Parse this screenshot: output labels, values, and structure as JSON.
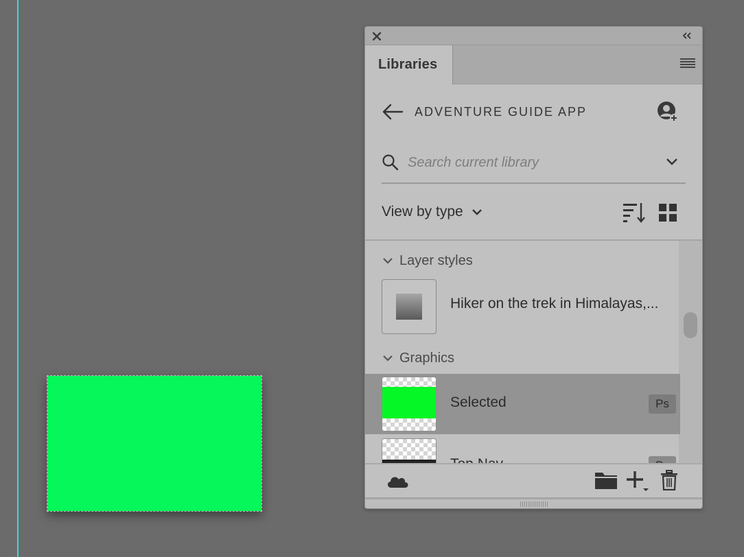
{
  "canvas": {
    "guide_color": "#3fd6dc",
    "shape_color": "#05f75a"
  },
  "panel": {
    "close_icon": "close-icon",
    "collapse_icon": "double-chevron-left-icon",
    "menu_icon": "hamburger-menu-icon",
    "tab_label": "Libraries",
    "library": {
      "back_icon": "arrow-left-icon",
      "title": "ADVENTURE GUIDE APP",
      "user_icon": "add-user-icon"
    },
    "search": {
      "placeholder": "Search current library",
      "value": "",
      "icon": "search-icon",
      "dropdown_icon": "chevron-down-icon"
    },
    "view": {
      "label": "View by type",
      "sort_icon": "sort-icon",
      "grid_icon": "grid-view-icon"
    },
    "sections": [
      {
        "title": "Layer styles",
        "items": [
          {
            "label": "Hiker on the trek in Himalayas,..."
          }
        ]
      },
      {
        "title": "Graphics",
        "items": [
          {
            "label": "Selected",
            "badge": "Ps",
            "selected": true
          },
          {
            "label": "Top Nav",
            "badge": "Ps",
            "selected": false
          }
        ]
      }
    ],
    "footer": {
      "cloud_icon": "cloud-icon",
      "folder_icon": "folder-icon",
      "add_icon": "add-icon",
      "trash_icon": "trash-icon"
    }
  }
}
